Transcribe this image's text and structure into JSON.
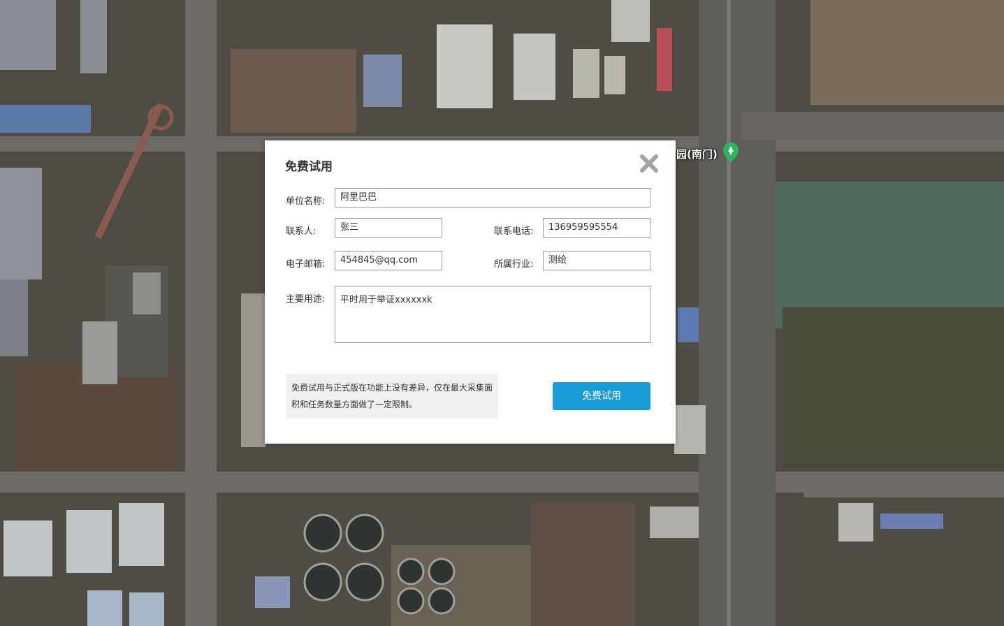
{
  "map": {
    "poi_label": "园(南门)",
    "poi_icon": "park-pin-icon"
  },
  "dialog": {
    "title": "免费试用",
    "close_icon": "close-icon",
    "fields": {
      "company": {
        "label": "单位名称:",
        "value": "阿里巴巴"
      },
      "contact": {
        "label": "联系人:",
        "value": "张三"
      },
      "phone": {
        "label": "联系电话:",
        "value": "136959595554"
      },
      "email": {
        "label": "电子邮箱:",
        "value": "454845@qq.com"
      },
      "industry": {
        "label": "所属行业:",
        "value": "测绘"
      },
      "purpose": {
        "label": "主要用途:",
        "value": "平时用于举证xxxxxxk"
      }
    },
    "notice": "免费试用与正式版在功能上没有差异，仅在最大采集面积和任务数量方面做了一定限制。",
    "submit_label": "免费试用"
  },
  "colors": {
    "accent": "#1a9ad6",
    "notice_bg": "#f1f1f1",
    "close_icon": "#a3a3a3",
    "pin": "#2bb65a"
  }
}
